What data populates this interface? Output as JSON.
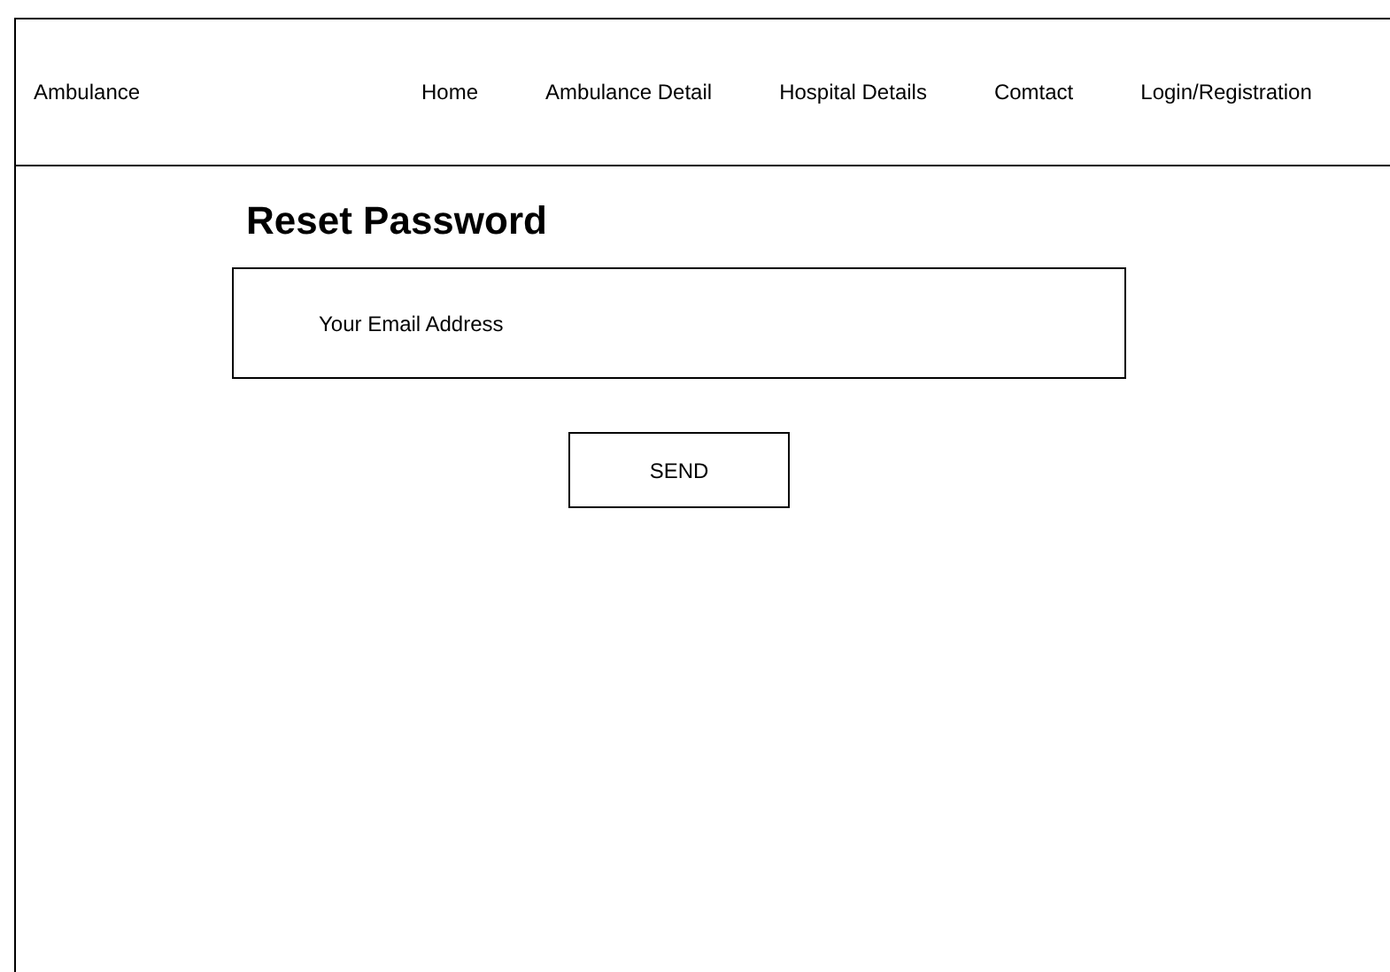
{
  "header": {
    "brand": "Ambulance",
    "nav": [
      {
        "label": "Home"
      },
      {
        "label": "Ambulance Detail"
      },
      {
        "label": "Hospital Details"
      },
      {
        "label": "Comtact"
      },
      {
        "label": "Login/Registration"
      }
    ]
  },
  "form": {
    "title": "Reset Password",
    "email": {
      "placeholder": "Your Email Address"
    },
    "button": "SEND"
  }
}
